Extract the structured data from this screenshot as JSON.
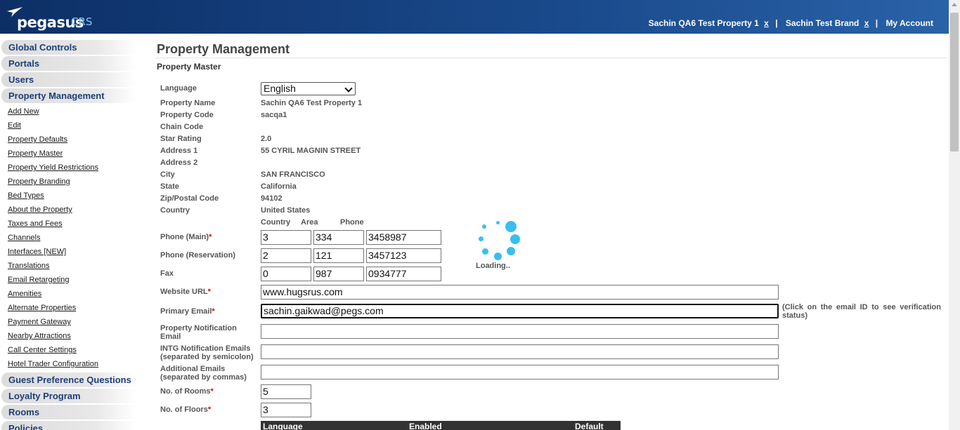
{
  "header": {
    "logo_word": "pegasus",
    "logo_suffix": "CRS",
    "property_link": "Sachin QA6 Test Property 1",
    "brand_link": "Sachin Test Brand",
    "remove_label": "x",
    "separator": "|",
    "account_link": "My Account"
  },
  "sidebar": {
    "sections_top": [
      "Global Controls",
      "Portals",
      "Users",
      "Property Management"
    ],
    "sub_items": [
      "Add New",
      "Edit",
      "Property Defaults",
      "Property Master",
      "Property Yield Restrictions",
      "Property Branding",
      "Bed Types",
      "About the Property",
      "Taxes and Fees",
      "Channels",
      "Interfaces [NEW]",
      "Translations",
      "Email Retargeting",
      "Amenities",
      "Alternate Properties",
      "Payment Gateway",
      "Nearby Attractions",
      "Call Center Settings",
      "Hotel Trader Configuration"
    ],
    "sections_bottom": [
      "Guest Preference Questions",
      "Loyalty Program",
      "Rooms",
      "Policies"
    ]
  },
  "main": {
    "title": "Property Management",
    "subtitle": "Property Master"
  },
  "form": {
    "language_label": "Language",
    "language_value": "English",
    "property_name_label": "Property Name",
    "property_name": "Sachin QA6 Test Property 1",
    "property_code_label": "Property Code",
    "property_code": "sacqa1",
    "chain_code_label": "Chain Code",
    "star_rating_label": "Star Rating",
    "star_rating": "2.0",
    "address1_label": "Address 1",
    "address1": "55 CYRIL MAGNIN STREET",
    "address2_label": "Address 2",
    "city_label": "City",
    "city": "SAN FRANCISCO",
    "state_label": "State",
    "state": "California",
    "zip_label": "Zip/Postal Code",
    "zip": "94102",
    "country_label": "Country",
    "country": "United States",
    "col_country": "Country",
    "col_area": "Area",
    "col_phone": "Phone",
    "phone_main_label": "Phone (Main)",
    "phone_main": {
      "country": "3",
      "area": "334",
      "number": "3458987"
    },
    "phone_res_label": "Phone (Reservation)",
    "phone_res": {
      "country": "2",
      "area": "121",
      "number": "3457123"
    },
    "fax_label": "Fax",
    "fax": {
      "country": "0",
      "area": "987",
      "number": "0934777"
    },
    "website_label": "Website URL",
    "website": "www.hugsrus.com",
    "primary_email_label": "Primary Email",
    "primary_email": "sachin.gaikwad@pegs.com",
    "email_note": "(Click on the email ID to see verification status)",
    "notif_email_label_1": "Property Notification",
    "notif_email_label_2": "Email",
    "intg_label_1": "INTG Notification Emails",
    "intg_label_2": "(separated by semicolon)",
    "additional_label_1": "Additional Emails",
    "additional_label_2": "(separated by commas)",
    "rooms_label": "No. of Rooms",
    "rooms": "5",
    "floors_label": "No. of Floors",
    "floors": "3",
    "required_mark": "*",
    "loading": "Loading..",
    "lang_table_headers": [
      "Language",
      "Enabled",
      "Default"
    ]
  },
  "colors": {
    "header_dark": "#0d2f66",
    "accent_blue": "#37bff0",
    "nav_text": "#1c3e7a",
    "required": "#dd0000"
  }
}
